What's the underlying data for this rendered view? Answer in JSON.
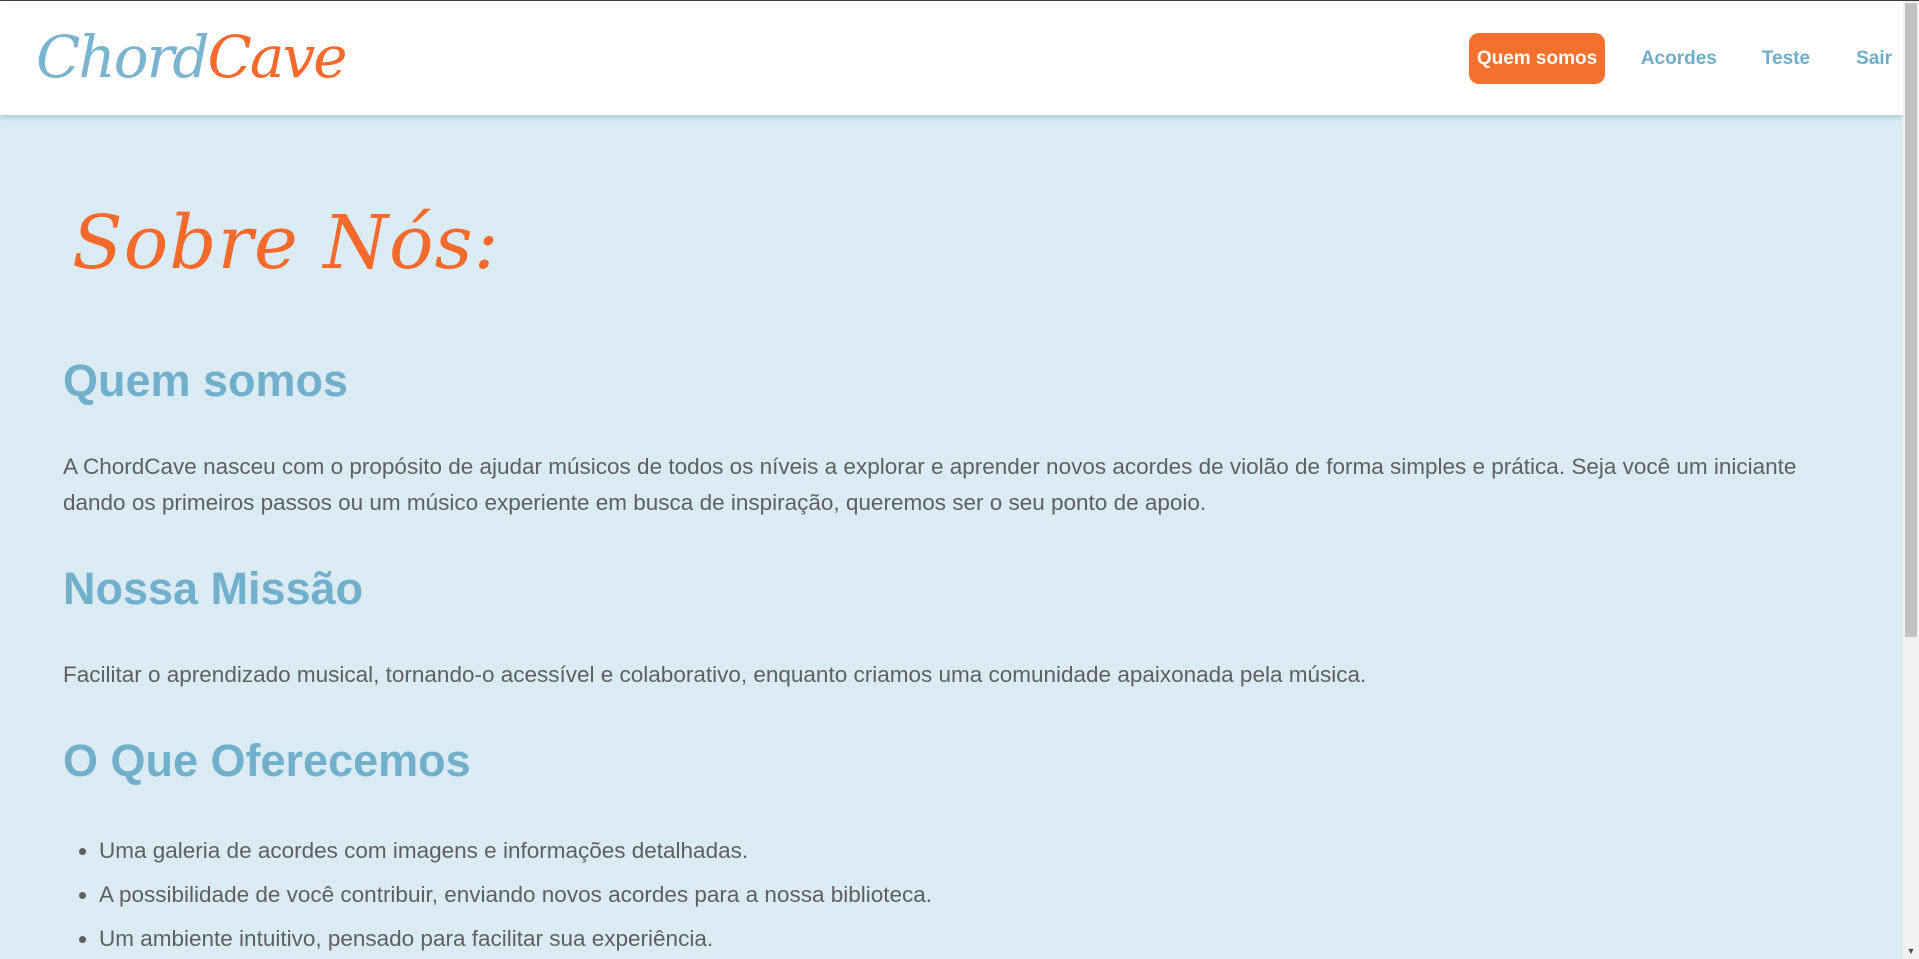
{
  "header": {
    "logo": {
      "part1": "Chord",
      "part2": "Cave"
    },
    "nav": [
      {
        "label": "Quem somos",
        "active": true
      },
      {
        "label": "Acordes",
        "active": false
      },
      {
        "label": "Teste",
        "active": false
      },
      {
        "label": "Sair",
        "active": false
      }
    ]
  },
  "main": {
    "title": "Sobre Nós:",
    "sections": [
      {
        "heading": "Quem somos",
        "text": "A ChordCave nasceu com o propósito de ajudar músicos de todos os níveis a explorar e aprender novos acordes de violão de forma simples e prática. Seja você um iniciante dando os primeiros passos ou um músico experiente em busca de inspiração, queremos ser o seu ponto de apoio."
      },
      {
        "heading": "Nossa Missão",
        "text": "Facilitar o aprendizado musical, tornando-o acessível e colaborativo, enquanto criamos uma comunidade apaixonada pela música."
      },
      {
        "heading": "O Que Oferecemos",
        "items": [
          "Uma galeria de acordes com imagens e informações detalhadas.",
          "A possibilidade de você contribuir, enviando novos acordes para a nossa biblioteca.",
          "Um ambiente intuitivo, pensado para facilitar sua experiência."
        ]
      }
    ]
  },
  "colors": {
    "accent_orange": "#f46a2c",
    "accent_blue": "#72afcb",
    "background": "#dbebf4",
    "body_text": "#5d5f61"
  }
}
